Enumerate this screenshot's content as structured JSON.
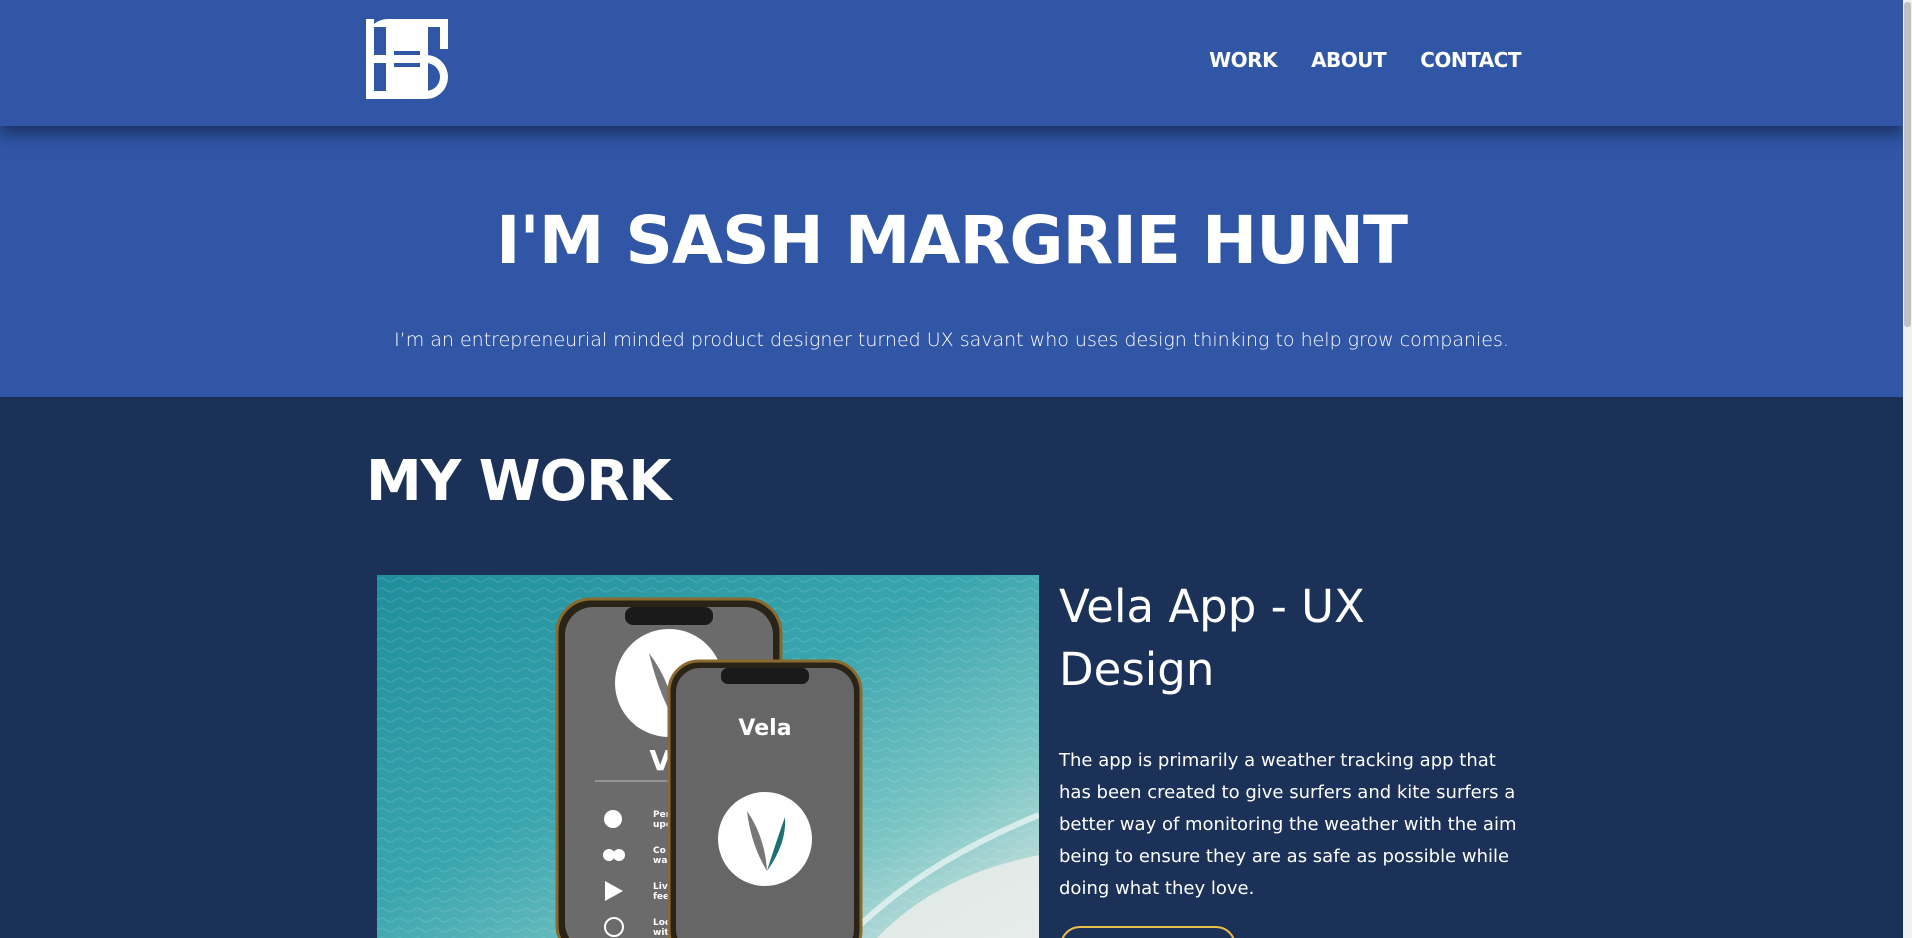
{
  "header": {
    "logo_alt": "SH",
    "nav": [
      {
        "label": "WORK"
      },
      {
        "label": "ABOUT"
      },
      {
        "label": "CONTACT"
      }
    ]
  },
  "hero": {
    "title": "I'M SASH MARGRIE HUNT",
    "subtitle": "I’m an entrepreneurial minded product designer turned UX savant who uses design thinking to help grow companies."
  },
  "work": {
    "title": "MY WORK",
    "projects": [
      {
        "title": "Vela App - UX Design",
        "description": "The app is primarily a weather tracking app that has been created to give surfers and kite surfers a better way of monitoring the weather with the aim being to ensure they are as safe as possible while doing what they love.",
        "image": {
          "app_name": "Vela",
          "app_name_partial": "Ve",
          "feature_texts": [
            "Per",
            "upd",
            "Co",
            "wa",
            "Liv",
            "fee",
            "Loc",
            "wit"
          ]
        }
      }
    ]
  },
  "colors": {
    "header_bg": "#3056a5",
    "section_bg": "#1b3157",
    "accent": "#e9c04a",
    "text": "#ffffff"
  }
}
